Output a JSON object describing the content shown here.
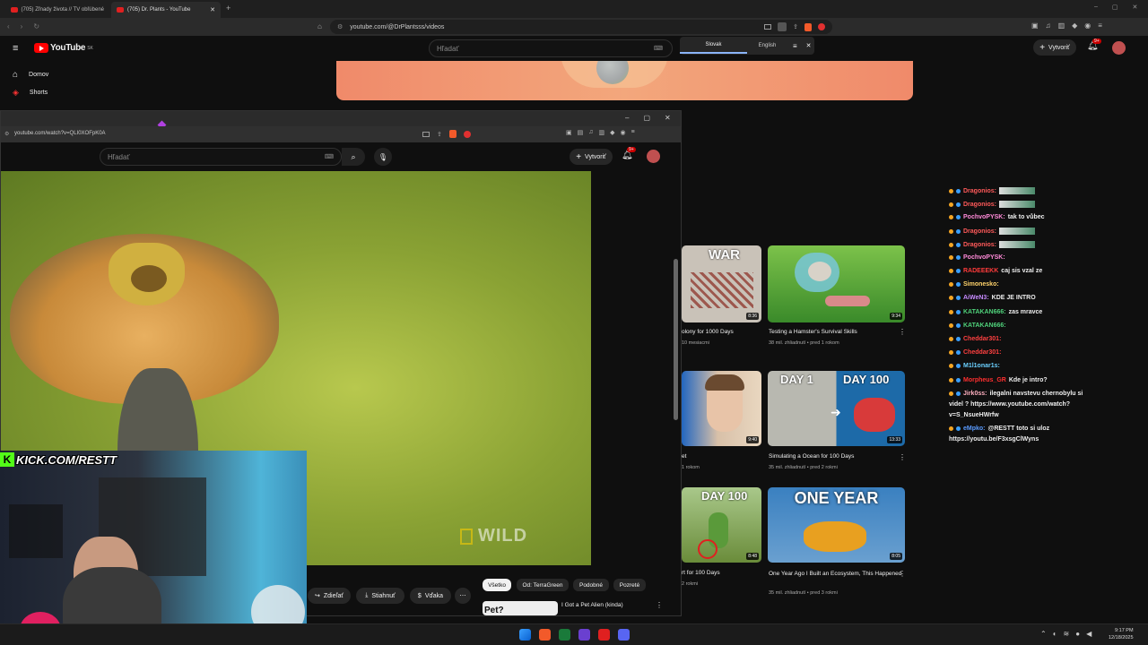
{
  "browser": {
    "tabs": [
      {
        "label": "(705) Zľnady života // TV obľúbené"
      },
      {
        "label": "(705) Dr. Plants - YouTube"
      }
    ],
    "url": "youtube.com/@DrPlantsss/videos"
  },
  "youtube_bg": {
    "logo_text": "YouTube",
    "region": "SK",
    "search_placeholder": "Hľadať",
    "create_label": "Vytvoriť",
    "notif_count": "9+",
    "sidebar": [
      {
        "label": "Domov",
        "icon": "home-icon"
      },
      {
        "label": "Shorts",
        "icon": "shorts-icon"
      }
    ]
  },
  "translate": {
    "lang_from": "Slovak",
    "lang_to": "English"
  },
  "videos": [
    {
      "title": "olony for 1000 Days",
      "meta": "10 mesiacmi",
      "duration": "8:36",
      "thumb_text": "WAR",
      "thumb_color": "#c7c0b6"
    },
    {
      "title": "Testing a Hamster's Survival Skills",
      "meta": "38 mil. zhliadnutí • pred 1 rokom",
      "duration": "9:34",
      "thumb_text": "",
      "thumb_color": "#5aa03a"
    },
    {
      "title": "et",
      "meta": "1 rokom",
      "duration": "9:40",
      "thumb_text": "",
      "thumb_color": "#2a70c8"
    },
    {
      "title": "Simulating a Ocean for 100 Days",
      "meta": "35 mil. zhliadnutí • pred 2 rokmi",
      "duration": "13:33",
      "thumb_text_left": "DAY 1",
      "thumb_text_right": "DAY 100",
      "thumb_color": "#9aa0a0"
    },
    {
      "title": "rt for 100 Days",
      "meta": "2 rokmi",
      "duration": "8:48",
      "thumb_text": "DAY 100",
      "thumb_color": "#6a8c3a"
    },
    {
      "title": "One Year Ago I Built an Ecosystem, This Happened",
      "meta": "35 mil. zhliadnutí • pred 3 rokmi",
      "duration": "8:05",
      "thumb_text": "ONE YEAR",
      "thumb_color": "#3a80c0"
    }
  ],
  "chat": [
    {
      "user": "Dragonios:",
      "msg": "",
      "color": "#ff5a5a",
      "emote": true
    },
    {
      "user": "Dragonios:",
      "msg": "",
      "color": "#ff5a5a",
      "emote": true
    },
    {
      "user": "PochvoPYSK:",
      "msg": "tak to vůbec",
      "color": "#ff8ad8",
      "emote": false
    },
    {
      "user": "Dragonios:",
      "msg": "",
      "color": "#ff5a5a",
      "emote": true
    },
    {
      "user": "Dragonios:",
      "msg": "",
      "color": "#ff5a5a",
      "emote": true
    },
    {
      "user": "PochvoPYSK:",
      "msg": "",
      "color": "#ff8ad8",
      "emote": false
    },
    {
      "user": "RADEEEKK",
      "msg": "caj sis vzal ze",
      "color": "#ff3b3b",
      "emote": false
    },
    {
      "user": "Simonesko:",
      "msg": "",
      "color": "#ffd36b",
      "emote": false
    },
    {
      "user": "AiWeN3:",
      "msg": "KDE JE INTRO",
      "color": "#c78bff",
      "emote": false
    },
    {
      "user": "KATAKAN666:",
      "msg": "zas mravce",
      "color": "#4fd17a",
      "emote": false
    },
    {
      "user": "KATAKAN666:",
      "msg": "",
      "color": "#4fd17a",
      "emote": false
    },
    {
      "user": "Cheddar301:",
      "msg": "",
      "color": "#ff4040",
      "emote": false
    },
    {
      "user": "Cheddar301:",
      "msg": "",
      "color": "#ff4040",
      "emote": false
    },
    {
      "user": "M1l1onar1s:",
      "msg": "",
      "color": "#6bd0ff",
      "emote": false
    },
    {
      "user": "Morpheus_GR",
      "msg": "Kde je intro?",
      "color": "#ff2f2f",
      "emote": false
    },
    {
      "user": "Jirk0ss:",
      "msg": "ilegalni navstevu chernobylu si",
      "color": "#ffb0c0",
      "emote": false
    },
    {
      "user": "",
      "msg": "videl ? https://www.youtube.com/watch?",
      "color": "#eee",
      "emote": false
    },
    {
      "user": "",
      "msg": "v=S_NsueHWrfw",
      "color": "#eee",
      "emote": false
    },
    {
      "user": "eMpko:",
      "msg": "@RESTT toto si uloz",
      "color": "#5a9bff",
      "emote": false
    },
    {
      "user": "",
      "msg": "https://youtu.be/F3xsgClWyns",
      "color": "#eee",
      "emote": false
    }
  ],
  "popup": {
    "url": "youtube.com/watch?v=QLI0XOFpK0A",
    "search_placeholder": "Hľadať",
    "create_label": "Vytvoriť",
    "notif_count": "9+",
    "watermark": "WILD",
    "actions": [
      {
        "label": "Zdieľať",
        "icon": "share-icon"
      },
      {
        "label": "Stiahnuť",
        "icon": "download-icon"
      },
      {
        "label": "Vďaka",
        "icon": "thanks-icon"
      }
    ],
    "chips": [
      "Všetko",
      "Od: TerraGreen",
      "Podobné",
      "Pozreté"
    ],
    "next_title": "I Got a Pet Alien (kinda)",
    "next_thumb_text": "Pet?"
  },
  "stream": {
    "overlay_text": "KICK.COM/RESTT",
    "kick_letter": "K"
  },
  "taskbar": {
    "time": "9:17 PM",
    "date": "12/18/2025"
  }
}
